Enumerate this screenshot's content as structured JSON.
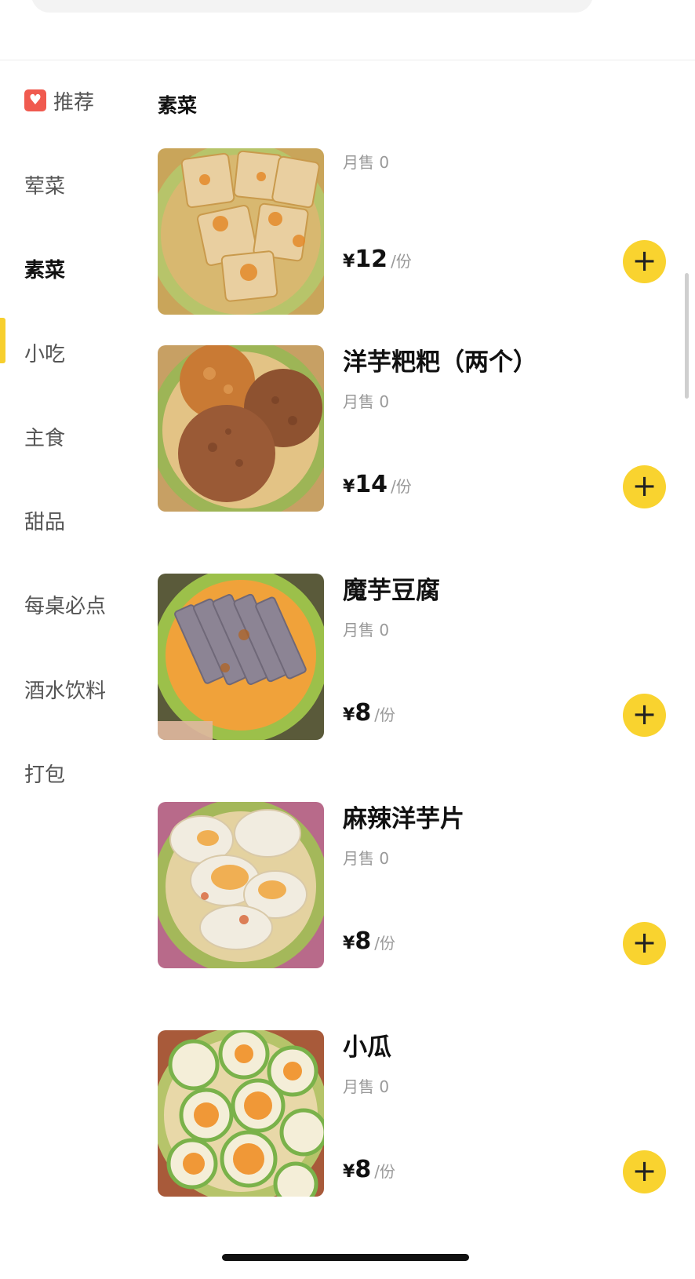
{
  "sidebar": {
    "items": [
      {
        "label": "推荐",
        "icon": "heart-icon"
      },
      {
        "label": "荤菜"
      },
      {
        "label": "素菜",
        "active": true
      },
      {
        "label": "小吃"
      },
      {
        "label": "主食"
      },
      {
        "label": "甜品"
      },
      {
        "label": "每桌必点"
      },
      {
        "label": "酒水饮料"
      },
      {
        "label": "打包"
      }
    ]
  },
  "main": {
    "category_title": "素菜",
    "dishes": [
      {
        "name": "",
        "sales": "月售 0",
        "currency": "¥",
        "price": "12",
        "unit": "/份"
      },
      {
        "name": "洋芋粑粑（两个）",
        "sales": "月售 0",
        "currency": "¥",
        "price": "14",
        "unit": "/份"
      },
      {
        "name": "魔芋豆腐",
        "sales": "月售 0",
        "currency": "¥",
        "price": "8",
        "unit": "/份"
      },
      {
        "name": "麻辣洋芋片",
        "sales": "月售 0",
        "currency": "¥",
        "price": "8",
        "unit": "/份"
      },
      {
        "name": "小瓜",
        "sales": "月售 0",
        "currency": "¥",
        "price": "8",
        "unit": "/份"
      }
    ],
    "add_label": "+"
  },
  "colors": {
    "accent": "#f9d32f",
    "active_indicator": "#f7cf2e",
    "recommend_icon": "#f05a4f"
  }
}
